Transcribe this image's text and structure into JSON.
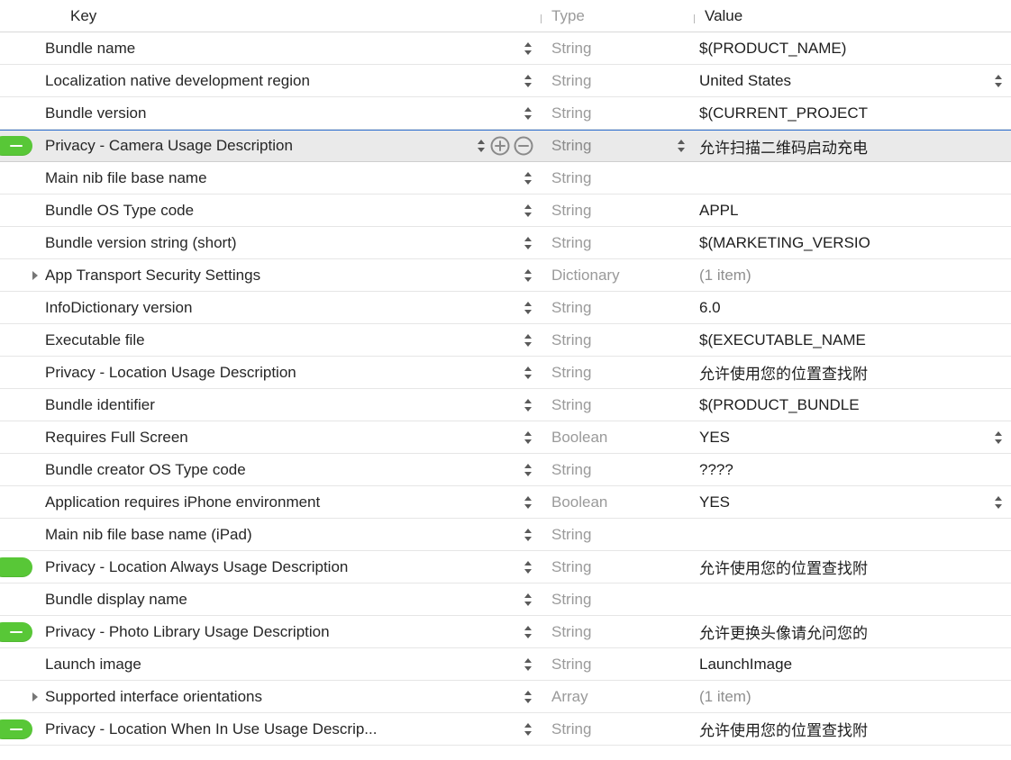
{
  "headers": {
    "key": "Key",
    "type": "Type",
    "value": "Value"
  },
  "rows": [
    {
      "key": "Bundle name",
      "type": "String",
      "value": "$(PRODUCT_NAME)",
      "selected": false,
      "expandable": false,
      "valueStepper": false,
      "badge": null,
      "showAddRemove": false,
      "mutedValue": false
    },
    {
      "key": "Localization native development region",
      "type": "String",
      "value": "United States",
      "selected": false,
      "expandable": false,
      "valueStepper": true,
      "badge": null,
      "showAddRemove": false,
      "mutedValue": false
    },
    {
      "key": "Bundle version",
      "type": "String",
      "value": "$(CURRENT_PROJECT",
      "selected": false,
      "expandable": false,
      "valueStepper": false,
      "badge": null,
      "showAddRemove": false,
      "mutedValue": false
    },
    {
      "key": "Privacy - Camera Usage Description",
      "type": "String",
      "value": "允许扫描二维码启动充电",
      "selected": true,
      "expandable": false,
      "valueStepper": false,
      "badge": "dash",
      "showAddRemove": true,
      "mutedValue": false
    },
    {
      "key": "Main nib file base name",
      "type": "String",
      "value": "",
      "selected": false,
      "expandable": false,
      "valueStepper": false,
      "badge": null,
      "showAddRemove": false,
      "mutedValue": false
    },
    {
      "key": "Bundle OS Type code",
      "type": "String",
      "value": "APPL",
      "selected": false,
      "expandable": false,
      "valueStepper": false,
      "badge": null,
      "showAddRemove": false,
      "mutedValue": false
    },
    {
      "key": "Bundle version string (short)",
      "type": "String",
      "value": "$(MARKETING_VERSIO",
      "selected": false,
      "expandable": false,
      "valueStepper": false,
      "badge": null,
      "showAddRemove": false,
      "mutedValue": false
    },
    {
      "key": "App Transport Security Settings",
      "type": "Dictionary",
      "value": "(1 item)",
      "selected": false,
      "expandable": true,
      "valueStepper": false,
      "badge": null,
      "showAddRemove": false,
      "mutedValue": true
    },
    {
      "key": "InfoDictionary version",
      "type": "String",
      "value": "6.0",
      "selected": false,
      "expandable": false,
      "valueStepper": false,
      "badge": null,
      "showAddRemove": false,
      "mutedValue": false
    },
    {
      "key": "Executable file",
      "type": "String",
      "value": "$(EXECUTABLE_NAME",
      "selected": false,
      "expandable": false,
      "valueStepper": false,
      "badge": null,
      "showAddRemove": false,
      "mutedValue": false
    },
    {
      "key": "Privacy - Location Usage Description",
      "type": "String",
      "value": "允许使用您的位置查找附",
      "selected": false,
      "expandable": false,
      "valueStepper": false,
      "badge": null,
      "showAddRemove": false,
      "mutedValue": false
    },
    {
      "key": "Bundle identifier",
      "type": "String",
      "value": "$(PRODUCT_BUNDLE",
      "selected": false,
      "expandable": false,
      "valueStepper": false,
      "badge": null,
      "showAddRemove": false,
      "mutedValue": false
    },
    {
      "key": "Requires Full Screen",
      "type": "Boolean",
      "value": "YES",
      "selected": false,
      "expandable": false,
      "valueStepper": true,
      "badge": null,
      "showAddRemove": false,
      "mutedValue": false
    },
    {
      "key": "Bundle creator OS Type code",
      "type": "String",
      "value": "????",
      "selected": false,
      "expandable": false,
      "valueStepper": false,
      "badge": null,
      "showAddRemove": false,
      "mutedValue": false
    },
    {
      "key": "Application requires iPhone environment",
      "type": "Boolean",
      "value": "YES",
      "selected": false,
      "expandable": false,
      "valueStepper": true,
      "badge": null,
      "showAddRemove": false,
      "mutedValue": false
    },
    {
      "key": "Main nib file base name (iPad)",
      "type": "String",
      "value": "",
      "selected": false,
      "expandable": false,
      "valueStepper": false,
      "badge": null,
      "showAddRemove": false,
      "mutedValue": false
    },
    {
      "key": "Privacy - Location Always Usage Description",
      "type": "String",
      "value": "允许使用您的位置查找附",
      "selected": false,
      "expandable": false,
      "valueStepper": false,
      "badge": "plain",
      "showAddRemove": false,
      "mutedValue": false
    },
    {
      "key": "Bundle display name",
      "type": "String",
      "value": "",
      "selected": false,
      "expandable": false,
      "valueStepper": false,
      "badge": null,
      "showAddRemove": false,
      "mutedValue": false
    },
    {
      "key": "Privacy - Photo Library Usage Description",
      "type": "String",
      "value": "允许更换头像请允问您的",
      "selected": false,
      "expandable": false,
      "valueStepper": false,
      "badge": "dash",
      "showAddRemove": false,
      "mutedValue": false
    },
    {
      "key": "Launch image",
      "type": "String",
      "value": "LaunchImage",
      "selected": false,
      "expandable": false,
      "valueStepper": false,
      "badge": null,
      "showAddRemove": false,
      "mutedValue": false
    },
    {
      "key": "Supported interface orientations",
      "type": "Array",
      "value": "(1 item)",
      "selected": false,
      "expandable": true,
      "valueStepper": false,
      "badge": null,
      "showAddRemove": false,
      "mutedValue": true
    },
    {
      "key": "Privacy - Location When In Use Usage Descrip...",
      "type": "String",
      "value": "允许使用您的位置查找附",
      "selected": false,
      "expandable": false,
      "valueStepper": false,
      "badge": "dash",
      "showAddRemove": false,
      "mutedValue": false
    }
  ]
}
